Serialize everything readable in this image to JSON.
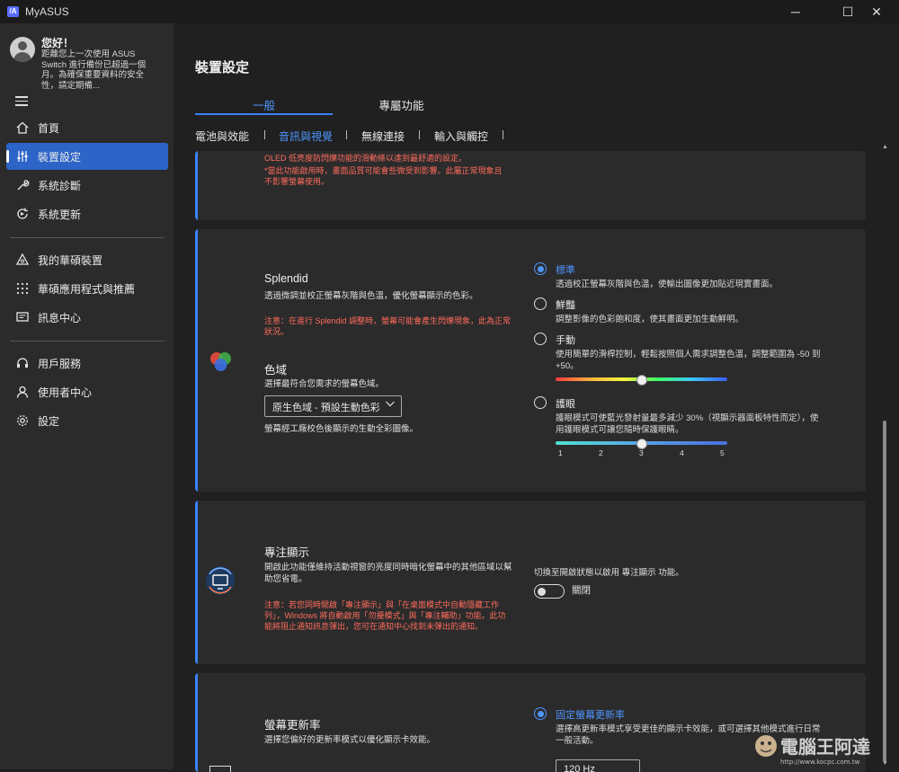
{
  "window": {
    "title": "MyASUS",
    "minimize": "─",
    "maximize": "☐",
    "close": "✕"
  },
  "sidebar": {
    "greeting_title": "您好！",
    "greeting_text": "距離您上一次使用 ASUS Switch 進行備份已超過一個月。為確保重要資料的安全性，請定期備...",
    "items": [
      {
        "label": "首頁",
        "icon": "home-icon"
      },
      {
        "label": "裝置設定",
        "icon": "sliders-icon",
        "active": true
      },
      {
        "label": "系統診斷",
        "icon": "wrench-icon"
      },
      {
        "label": "系統更新",
        "icon": "update-icon"
      },
      {
        "label": "我的華碩裝置",
        "icon": "devices-icon"
      },
      {
        "label": "華碩應用程式與推薦",
        "icon": "apps-grid-icon"
      },
      {
        "label": "訊息中心",
        "icon": "message-icon"
      },
      {
        "label": "用戶服務",
        "icon": "headset-icon"
      },
      {
        "label": "使用者中心",
        "icon": "user-icon"
      },
      {
        "label": "設定",
        "icon": "gear-icon"
      }
    ]
  },
  "main": {
    "page_title": "裝置設定",
    "tabs": [
      {
        "label": "一般",
        "active": true
      },
      {
        "label": "專屬功能"
      }
    ],
    "subtabs": [
      {
        "label": "電池與效能"
      },
      {
        "label": "音訊與視覺",
        "active": true
      },
      {
        "label": "無線連接"
      },
      {
        "label": "輸入與觸控"
      }
    ]
  },
  "flicker_card": {
    "text1": "OLED 低亮度防閃爍功能的滑動條以達到最舒適的設定。",
    "warn": "*當此功能啟用時，畫面品質可能會些微受到影響。此屬正常現象且不影響螢幕使用。"
  },
  "splendid": {
    "title": "Splendid",
    "desc": "透過微調並校正螢幕灰階與色溫，優化螢幕顯示的色彩。",
    "warn": "注意：在進行 Splendid 調整時，螢幕可能會產生閃爍現象，此為正常狀況。",
    "gamut_title": "色域",
    "gamut_desc": "選擇最符合您需求的螢幕色域。",
    "gamut_value": "原生色域 - 預設生動色彩",
    "gamut_note": "螢幕經工廠校色後顯示的生動全彩圖像。",
    "options": [
      {
        "label": "標準",
        "desc": "透過校正螢幕灰階與色溫，使輸出圖像更加貼近現實畫面。",
        "selected": true
      },
      {
        "label": "鮮豔",
        "desc": "調整影像的色彩飽和度，使其畫面更加生動鮮明。"
      },
      {
        "label": "手動",
        "desc": "使用簡單的滑桿控制，輕鬆按照個人需求調整色溫，調整範圍為 -50 到 +50。"
      },
      {
        "label": "護眼",
        "desc": "護眼模式可使藍光發射量最多減少 30%（視顯示器面板特性而定），使用護眼模式可讓您隨時保護眼睛。"
      }
    ],
    "manual_value": 0,
    "eyecare_level": 3,
    "eyecare_ticks": [
      "1",
      "2",
      "3",
      "4",
      "5"
    ]
  },
  "focus": {
    "title": "專注顯示",
    "desc": "開啟此功能僅維持活動視窗的亮度同時暗化螢幕中的其他區域以幫助您省電。",
    "warn": "注意：若您同時開啟「專注顯示」與「在桌面模式中自動隱藏工作列」，Windows 將自動啟用「勿擾模式」與「專注輔助」功能。此功能將阻止通知訊息彈出，您可在通知中心找到未彈出的通知。",
    "toggle_desc": "切換至開啟狀態以啟用 專注顯示 功能。",
    "toggle_state": "關閉"
  },
  "refresh": {
    "title": "螢幕更新率",
    "desc": "選擇您偏好的更新率模式以優化顯示卡效能。",
    "option_label": "固定螢幕更新率",
    "option_desc": "選擇高更新率模式享受更佳的顯示卡效能，或可選擇其他模式進行日常一般活動。",
    "select_value": "120 Hz"
  },
  "watermark": {
    "text": "電腦王阿達",
    "url": "http://www.kocpc.com.tw"
  },
  "colors": {
    "accent": "#3b82f6",
    "accent_text": "#4f95ff",
    "warning": "#ff6b5c",
    "sidebar_bg": "#2b2b2b",
    "main_bg": "#202020",
    "card_bg": "#2b2b2b"
  }
}
